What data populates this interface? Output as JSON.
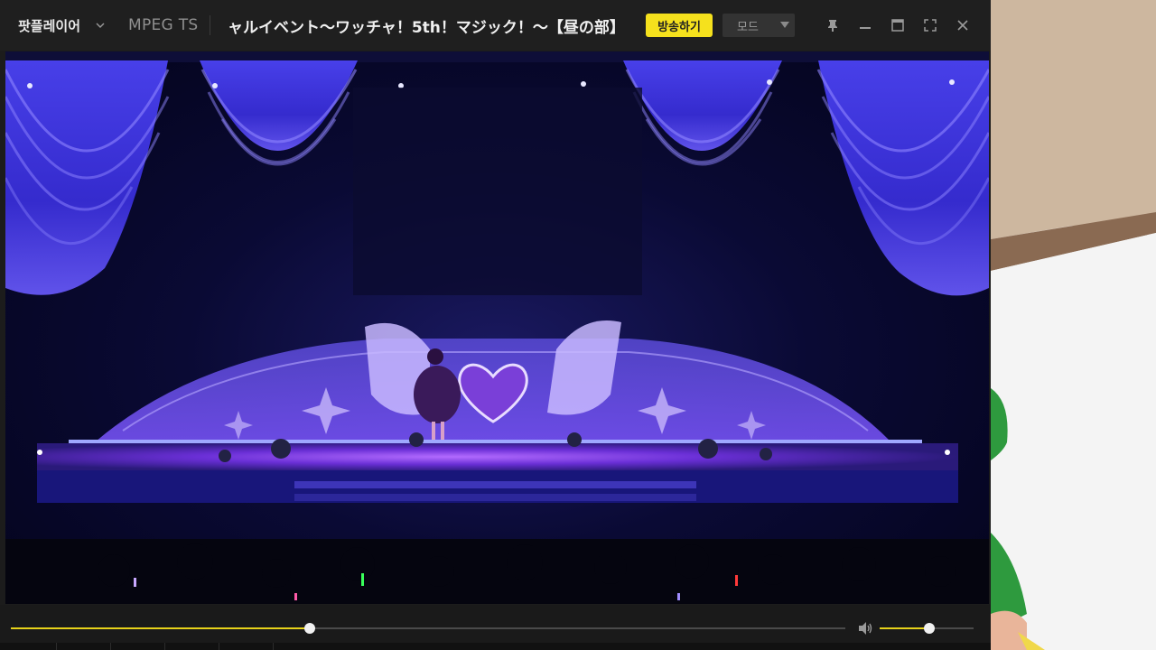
{
  "titlebar": {
    "brand": "팟플레이어",
    "format": "MPEG TS",
    "title": "ャルイベント～ワッチャ！5th！マジック！～【昼の部】",
    "broadcast_label": "방송하기",
    "mode_label": "모드"
  },
  "icons": {
    "brand_caret": "chevron-down-icon",
    "pin": "pin-icon",
    "minimize": "minimize-icon",
    "maximize": "maximize-icon",
    "fullscreen": "fullscreen-icon",
    "close": "close-icon",
    "volume": "volume-icon"
  },
  "playback": {
    "progress": 0.358,
    "volume": 0.53
  },
  "colors": {
    "accent": "#e7d21a",
    "broadcast_button": "#f5e11d",
    "stage_light": "#5b3cff"
  }
}
